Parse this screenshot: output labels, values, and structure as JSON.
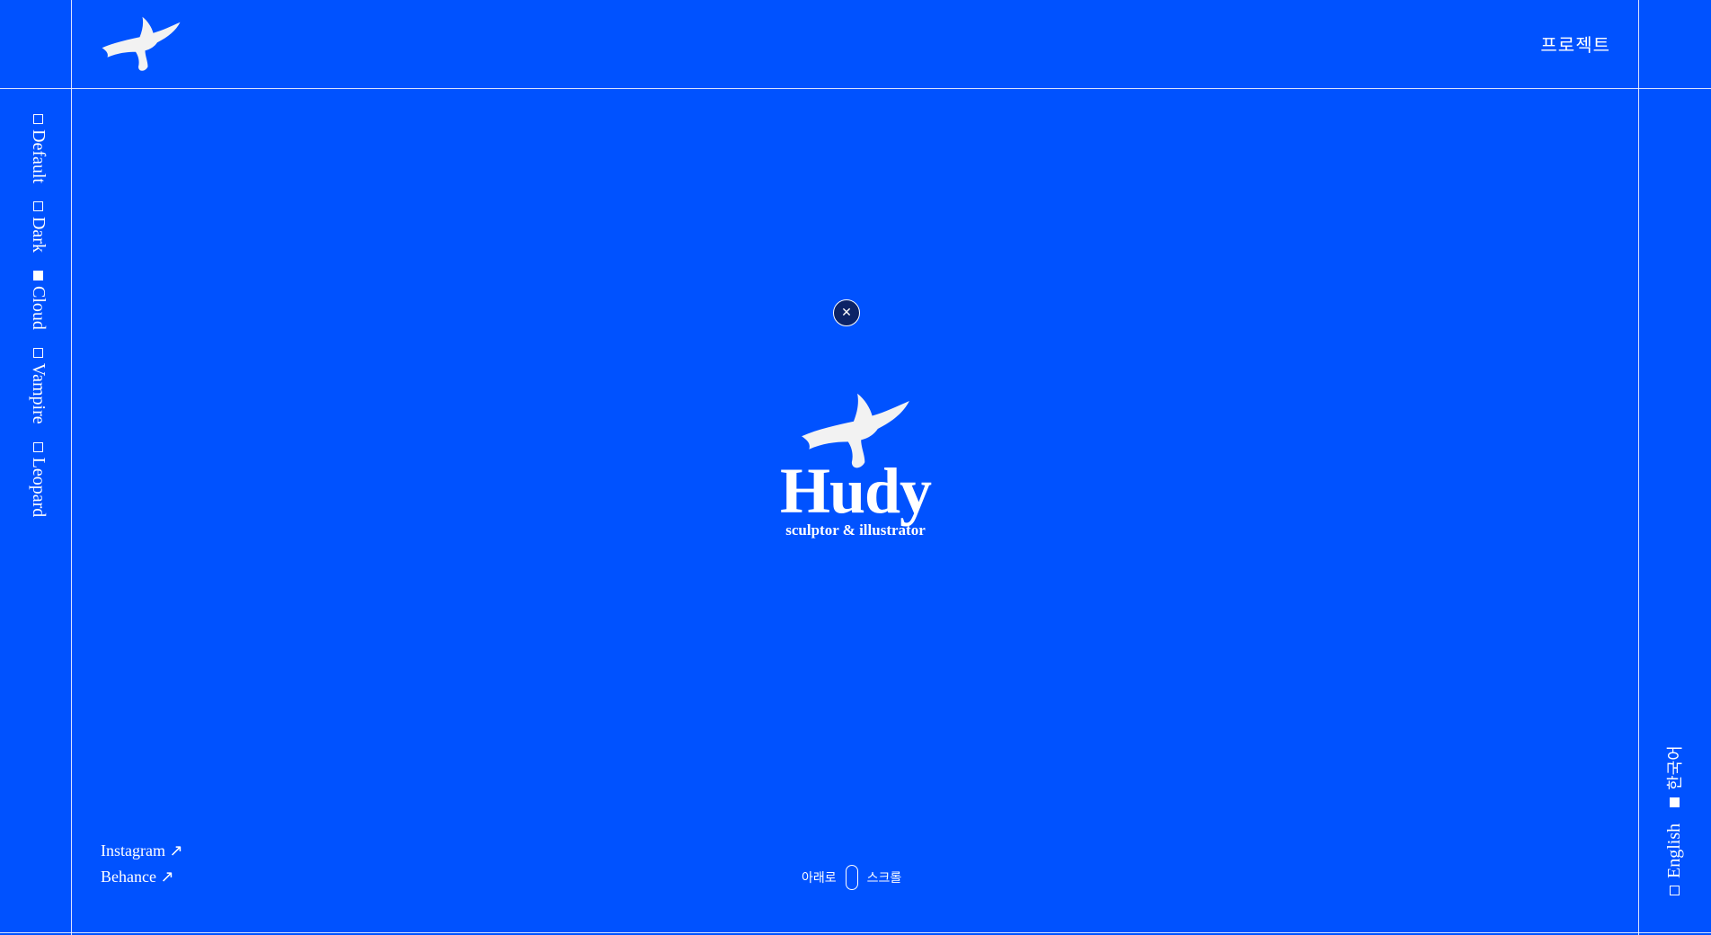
{
  "theme": {
    "background": "#0052ff",
    "foreground": "#ffffff",
    "close_button_bg": "#0c2366"
  },
  "header": {
    "logo_icon": "shark-logo-icon",
    "nav_projects_label": "프로젝트"
  },
  "themes": [
    {
      "label": "Default",
      "selected": false
    },
    {
      "label": "Dark",
      "selected": false
    },
    {
      "label": "Cloud",
      "selected": true
    },
    {
      "label": "Vampire",
      "selected": false
    },
    {
      "label": "Leopard",
      "selected": false
    }
  ],
  "languages": [
    {
      "label": "English",
      "selected": false
    },
    {
      "label": "한국어",
      "selected": true
    }
  ],
  "hero": {
    "close_icon": "close-icon",
    "close_glyph": "✕",
    "title": "Hudy",
    "subtitle": "sculptor & illustrator"
  },
  "social": {
    "instagram_label": "Instagram ↗",
    "behance_label": "Behance ↗"
  },
  "scroll_hint": {
    "left_label": "아래로",
    "right_label": "스크롤",
    "icon": "mouse-icon"
  }
}
